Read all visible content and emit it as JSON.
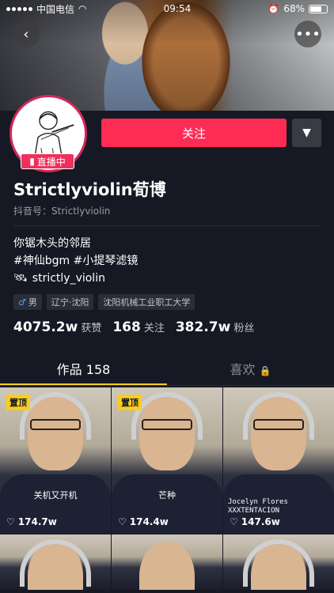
{
  "status_bar": {
    "carrier": "中国电信",
    "time": "09:54",
    "battery": "68%"
  },
  "profile": {
    "live_badge": "直播中",
    "follow_label": "关注",
    "name": "Strictlyviolin荀博",
    "douyin_id": "抖音号：Strictlyviolin",
    "bio_lines": [
      "你锯木头的邻居",
      "#神仙bgm #小提琴滤镜"
    ],
    "link_text": "strictly_violin",
    "tags": [
      "男",
      "辽宁·沈阳",
      "沈阳机械工业职工大学"
    ],
    "stats": [
      {
        "value": "4075.2w",
        "label": "获赞"
      },
      {
        "value": "168",
        "label": "关注"
      },
      {
        "value": "382.7w",
        "label": "粉丝"
      }
    ]
  },
  "tabs": [
    {
      "label": "作品 158"
    },
    {
      "label": "喜欢"
    }
  ],
  "videos": [
    {
      "pin": "置顶",
      "caption": "关机又开机",
      "likes": "174.7w"
    },
    {
      "pin": "置顶",
      "caption": "芒种",
      "likes": "174.4w"
    },
    {
      "pin": "",
      "caption": "Jocelyn Flores\nXXXTENTACION",
      "likes": "147.6w"
    }
  ],
  "colors": {
    "background": "#161823",
    "follow": "#fe2c55",
    "accent_yellow": "#facc1e"
  }
}
